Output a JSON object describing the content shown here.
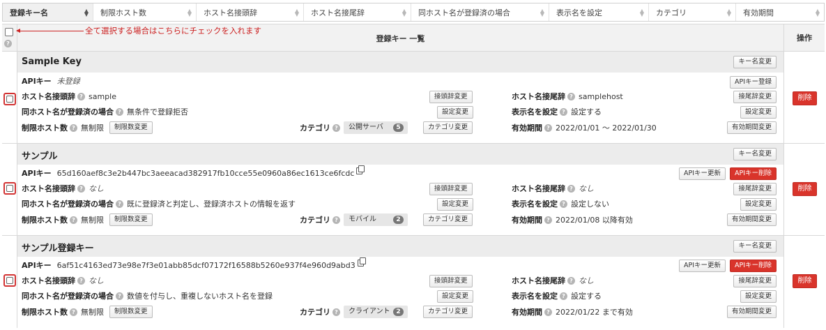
{
  "sort_columns": [
    {
      "label": "登録キー名",
      "active": true
    },
    {
      "label": "制限ホスト数",
      "active": false
    },
    {
      "label": "ホスト名接頭辞",
      "active": false
    },
    {
      "label": "ホスト名接尾辞",
      "active": false
    },
    {
      "label": "同ホスト名が登録済の場合",
      "active": false
    },
    {
      "label": "表示名を設定",
      "active": false
    },
    {
      "label": "カテゴリ",
      "active": false
    },
    {
      "label": "有効期間",
      "active": false
    }
  ],
  "select_all_note": "全て選択する場合はこちらにチェックを入れます",
  "table": {
    "title": "登録キー 一覧",
    "action_header": "操作",
    "help_glyph": "?"
  },
  "labels": {
    "api_key": "APIキー",
    "prefix": "ホスト名接頭辞",
    "suffix": "ホスト名接尾辞",
    "duplicate": "同ホスト名が登録済の場合",
    "display_name": "表示名を設定",
    "limit": "制限ホスト数",
    "category": "カテゴリ",
    "validity": "有効期間"
  },
  "buttons": {
    "rename": "キー名変更",
    "api_register": "APIキー登録",
    "api_renew": "APIキー更新",
    "api_delete": "APIキー削除",
    "prefix_change": "接頭辞変更",
    "suffix_change": "接尾辞変更",
    "setting_change": "設定変更",
    "limit_change": "制限数変更",
    "category_change": "カテゴリ変更",
    "validity_change": "有効期間変更",
    "delete": "削除"
  },
  "records": [
    {
      "name": "Sample Key",
      "api_key": "未登録",
      "prefix": "sample",
      "suffix": "samplehost",
      "duplicate": "無条件で登録拒否",
      "display_name": "設定する",
      "limit": "無制限",
      "category": "公開サーバ",
      "category_count": "5",
      "validity": "2022/01/01 ～ 2022/01/30"
    },
    {
      "name": "サンプル",
      "api_key": "65d160aef8c3e2b447bc3aeeacad382917fb10cce55e0960a86ec1613ce6fcdc",
      "prefix": "なし",
      "suffix": "なし",
      "duplicate": "既に登録済と判定し、登録済ホストの情報を返す",
      "display_name": "設定しない",
      "limit": "無制限",
      "category": "モバイル",
      "category_count": "2",
      "validity": "2022/01/08 以降有効"
    },
    {
      "name": "サンプル登録キー",
      "api_key": "6af51c4163ed73e98e7f3e01abb85dcf07172f16588b5260e937f4e960d9abd3",
      "prefix": "なし",
      "suffix": "なし",
      "duplicate": "数値を付与し、重複しないホスト名を登録",
      "display_name": "設定する",
      "limit": "無制限",
      "category": "クライアント",
      "category_count": "2",
      "validity": "2022/01/22 まで有効"
    }
  ]
}
